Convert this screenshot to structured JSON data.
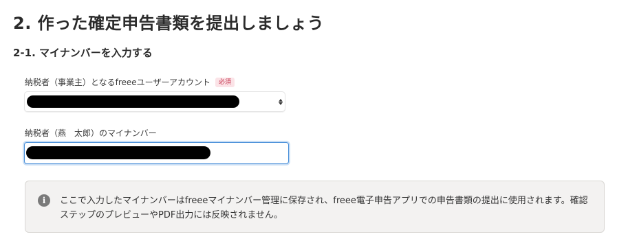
{
  "page": {
    "title": "2. 作った確定申告書類を提出しましょう"
  },
  "section": {
    "heading": "2-1. マイナンバーを入力する"
  },
  "account_field": {
    "label": "納税者（事業主）となるfreeeユーザーアカウント",
    "required_badge": "必須",
    "selected_value": "[redacted]"
  },
  "mynumber_field": {
    "label": "納税者（燕　太郎）のマイナンバー",
    "value": "[redacted]"
  },
  "info": {
    "icon": "info-icon",
    "text": "ここで入力したマイナンバーはfreeeマイナンバー管理に保存され、freee電子申告アプリでの申告書類の提出に使用されます。確認ステップのプレビューやPDF出力には反映されません。"
  },
  "colors": {
    "required_badge_text": "#c4314b",
    "required_badge_bg": "#fbe3e7",
    "input_focus_border": "#4a90d9",
    "info_box_bg": "#f3f2f1"
  }
}
